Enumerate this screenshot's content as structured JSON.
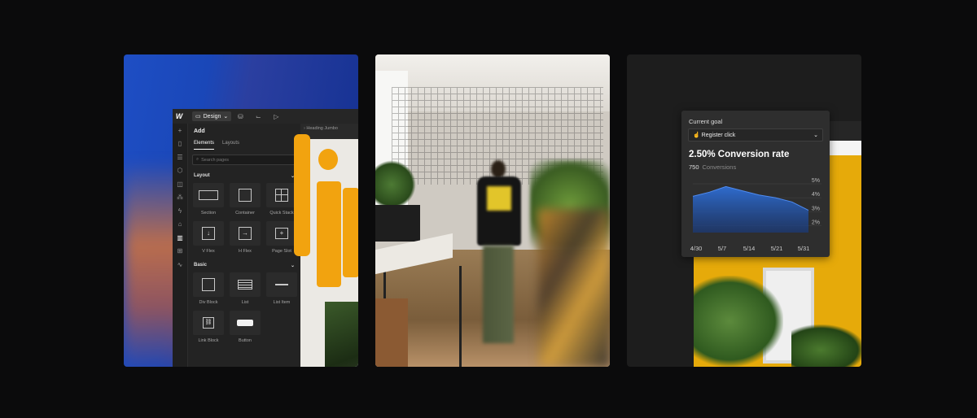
{
  "editor": {
    "top_menu": "Design",
    "panel_title": "Add",
    "tabs": [
      "Elements",
      "Layouts"
    ],
    "search_placeholder": "Search pages",
    "breadcrumb": "Heading Jumbo",
    "sections": [
      {
        "title": "Layout",
        "items": [
          "Section",
          "Container",
          "Quick Stack",
          "V Flex",
          "H Flex",
          "Page Slot"
        ]
      },
      {
        "title": "Basic",
        "items": [
          "Div Block",
          "List",
          "List Item",
          "Link Block",
          "Button"
        ]
      }
    ]
  },
  "goal_card": {
    "label": "Current goal",
    "selected_goal": "Register click",
    "rate": "2.50% Conversion rate",
    "conversions_value": "750",
    "conversions_label": "Conversions",
    "accent": "#2f6fd6"
  },
  "chart_data": {
    "type": "area",
    "x": [
      "4/30",
      "5/7",
      "5/14",
      "5/21",
      "5/31"
    ],
    "y_ticks": [
      "5%",
      "4%",
      "3%",
      "2%"
    ],
    "ylim": [
      1.5,
      5
    ],
    "series": [
      {
        "values": [
          4.1,
          4.4,
          4.8,
          4.5,
          4.2,
          4.0,
          3.7,
          3.1
        ]
      }
    ]
  }
}
